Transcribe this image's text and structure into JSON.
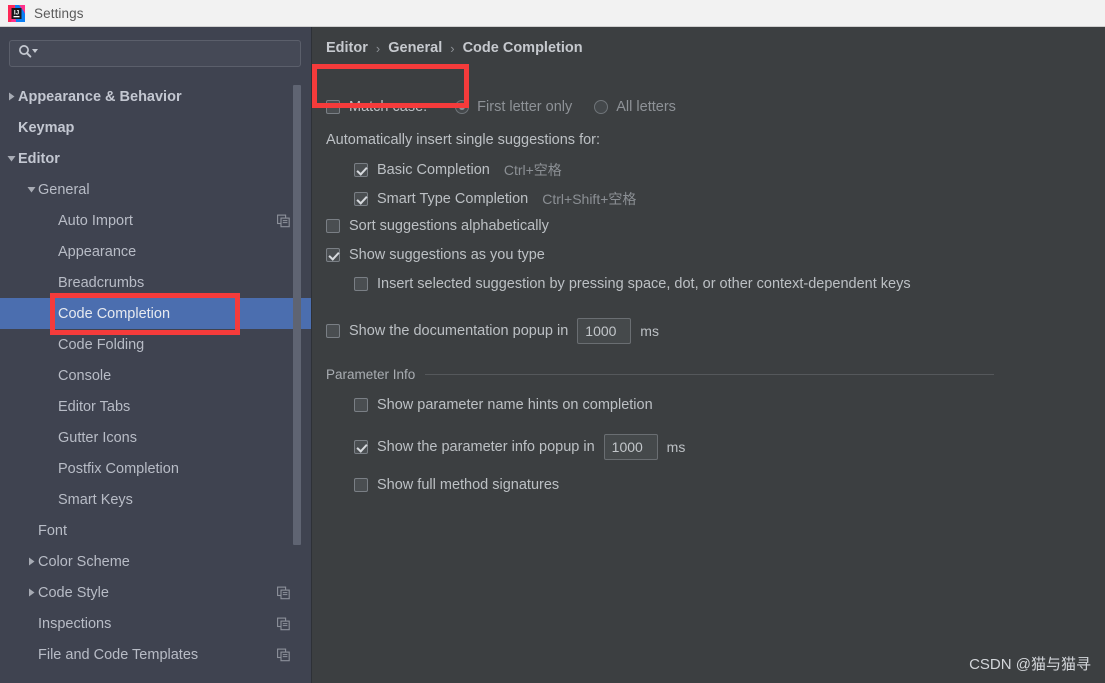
{
  "window": {
    "title": "Settings",
    "logo_icon": "intellij-idea-logo-icon"
  },
  "sidebar": {
    "search": {
      "placeholder": "",
      "value": "",
      "icon": "search-icon",
      "dropdown_icon": "chevron-down-icon"
    },
    "items": [
      {
        "label": "Appearance & Behavior",
        "indent": 0,
        "twisty": "collapsed",
        "bold": true,
        "selected": false,
        "badge": false
      },
      {
        "label": "Keymap",
        "indent": 0,
        "twisty": "none",
        "bold": true,
        "selected": false,
        "badge": false
      },
      {
        "label": "Editor",
        "indent": 0,
        "twisty": "expanded",
        "bold": true,
        "selected": false,
        "badge": false
      },
      {
        "label": "General",
        "indent": 1,
        "twisty": "expanded",
        "bold": false,
        "selected": false,
        "badge": false
      },
      {
        "label": "Auto Import",
        "indent": 2,
        "twisty": "none",
        "bold": false,
        "selected": false,
        "badge": true
      },
      {
        "label": "Appearance",
        "indent": 2,
        "twisty": "none",
        "bold": false,
        "selected": false,
        "badge": false
      },
      {
        "label": "Breadcrumbs",
        "indent": 2,
        "twisty": "none",
        "bold": false,
        "selected": false,
        "badge": false
      },
      {
        "label": "Code Completion",
        "indent": 2,
        "twisty": "none",
        "bold": false,
        "selected": true,
        "badge": false
      },
      {
        "label": "Code Folding",
        "indent": 2,
        "twisty": "none",
        "bold": false,
        "selected": false,
        "badge": false
      },
      {
        "label": "Console",
        "indent": 2,
        "twisty": "none",
        "bold": false,
        "selected": false,
        "badge": false
      },
      {
        "label": "Editor Tabs",
        "indent": 2,
        "twisty": "none",
        "bold": false,
        "selected": false,
        "badge": false
      },
      {
        "label": "Gutter Icons",
        "indent": 2,
        "twisty": "none",
        "bold": false,
        "selected": false,
        "badge": false
      },
      {
        "label": "Postfix Completion",
        "indent": 2,
        "twisty": "none",
        "bold": false,
        "selected": false,
        "badge": false
      },
      {
        "label": "Smart Keys",
        "indent": 2,
        "twisty": "none",
        "bold": false,
        "selected": false,
        "badge": false
      },
      {
        "label": "Font",
        "indent": 1,
        "twisty": "none",
        "bold": false,
        "selected": false,
        "badge": false
      },
      {
        "label": "Color Scheme",
        "indent": 1,
        "twisty": "collapsed",
        "bold": false,
        "selected": false,
        "badge": false
      },
      {
        "label": "Code Style",
        "indent": 1,
        "twisty": "collapsed",
        "bold": false,
        "selected": false,
        "badge": true
      },
      {
        "label": "Inspections",
        "indent": 1,
        "twisty": "none",
        "bold": false,
        "selected": false,
        "badge": true
      },
      {
        "label": "File and Code Templates",
        "indent": 1,
        "twisty": "none",
        "bold": false,
        "selected": false,
        "badge": true
      }
    ]
  },
  "main": {
    "breadcrumb": [
      "Editor",
      "General",
      "Code Completion"
    ],
    "breadcrumb_separator": "›",
    "match_case": {
      "label": "Match case:",
      "checked": false,
      "options": [
        {
          "label": "First letter only",
          "selected": true,
          "disabled": true
        },
        {
          "label": "All letters",
          "selected": false,
          "disabled": true
        }
      ]
    },
    "auto_insert_label": "Automatically insert single suggestions for:",
    "auto_insert_options": [
      {
        "label": "Basic Completion",
        "checked": true,
        "shortcut": "Ctrl+空格"
      },
      {
        "label": "Smart Type Completion",
        "checked": true,
        "shortcut": "Ctrl+Shift+空格"
      }
    ],
    "sort_alphabetically": {
      "label": "Sort suggestions alphabetically",
      "checked": false
    },
    "show_as_you_type": {
      "label": "Show suggestions as you type",
      "checked": true
    },
    "insert_by_space": {
      "label": "Insert selected suggestion by pressing space, dot, or other context-dependent keys",
      "checked": false
    },
    "doc_popup": {
      "label_before": "Show the documentation popup in",
      "value": "1000",
      "unit": "ms",
      "checked": false
    },
    "parameter_info": {
      "section_title": "Parameter Info",
      "name_hints": {
        "label": "Show parameter name hints on completion",
        "checked": false
      },
      "popup": {
        "label_before": "Show the parameter info popup in",
        "value": "1000",
        "unit": "ms",
        "checked": true
      },
      "full_signatures": {
        "label": "Show full method signatures",
        "checked": false
      }
    }
  },
  "watermark": "CSDN @猫与猫寻",
  "annotations": [
    {
      "name": "match-case-highlight"
    },
    {
      "name": "code-completion-highlight"
    }
  ],
  "colors": {
    "titlebar_bg": "#f2f2f2",
    "sidebar_bg": "#3f4350",
    "main_bg": "#3c3f41",
    "selection_blue": "#4b6eaf",
    "annotation_red": "#f53b3b",
    "text": "#bcc0c4",
    "text_dim": "#8e9297"
  }
}
